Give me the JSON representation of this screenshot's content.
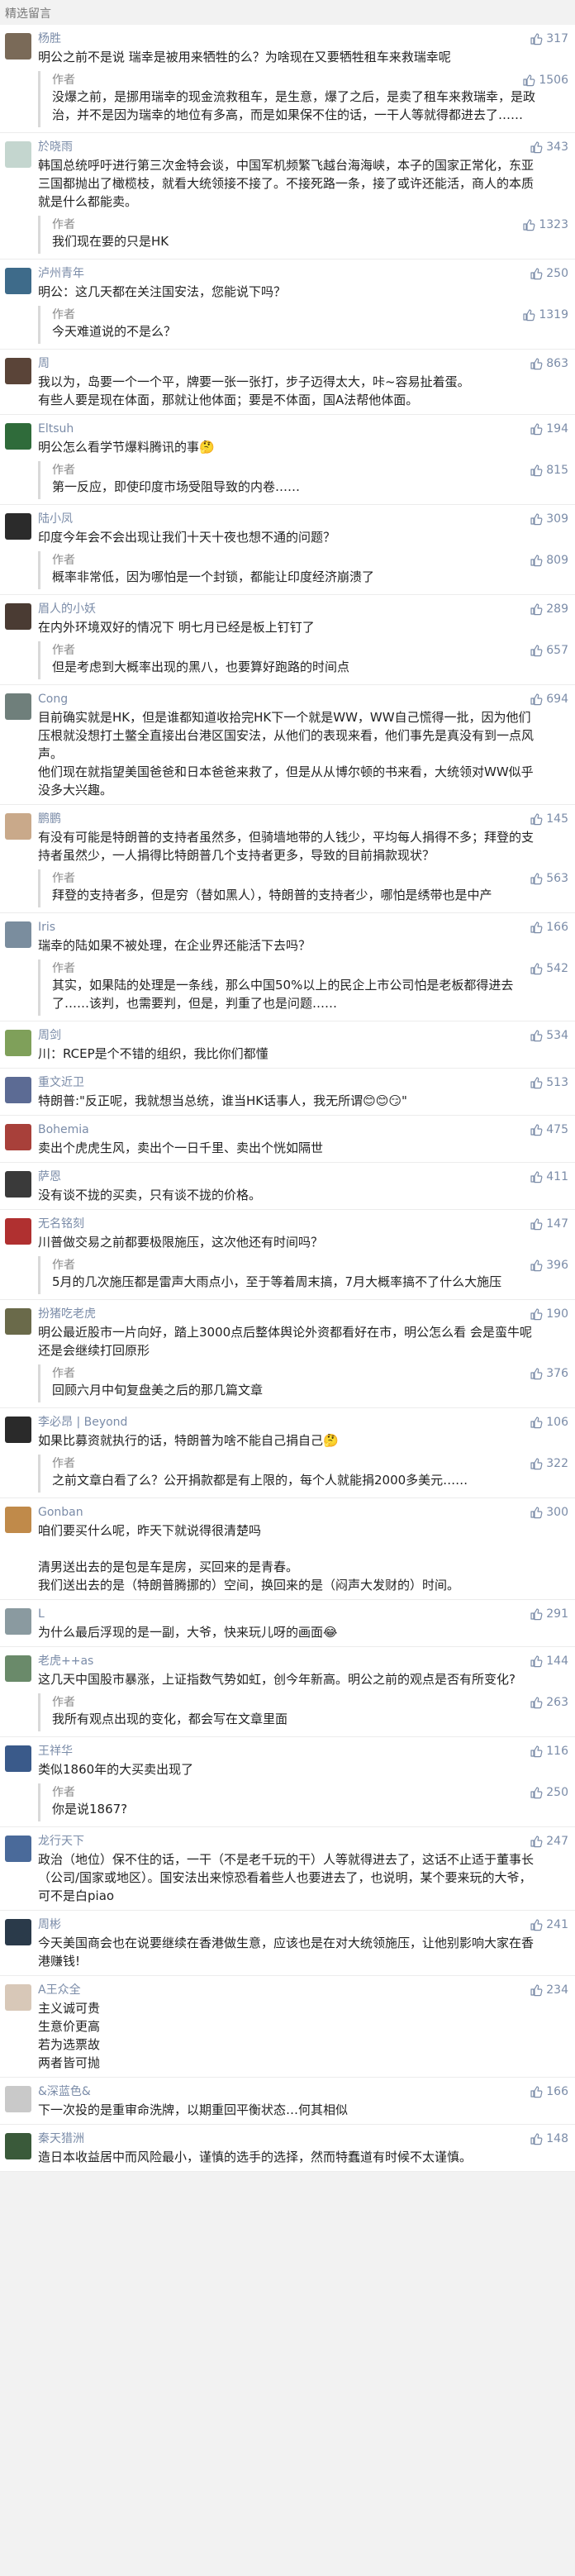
{
  "header": {
    "title": "精选留言"
  },
  "comments": [
    {
      "name": "杨胜",
      "likes": "317",
      "text": "明公之前不是说 瑞幸是被用来牺牲的么？为啥现在又要牺牲租车来救瑞幸呢",
      "reply": {
        "name": "作者",
        "likes": "1506",
        "text": "没爆之前，是挪用瑞幸的现金流救租车，是生意，爆了之后，是卖了租车来救瑞幸，是政治，并不是因为瑞幸的地位有多高，而是如果保不住的话，一干人等就得都进去了……"
      },
      "avatar": "#7a6a58"
    },
    {
      "name": "於晓雨",
      "likes": "343",
      "text": "韩国总统呼吁进行第三次金特会谈，中国军机频繁飞越台海海峡，本子的国家正常化，东亚三国都抛出了橄榄枝，就看大统领接不接了。不接死路一条，接了或许还能活，商人的本质就是什么都能卖。",
      "reply": {
        "name": "作者",
        "likes": "1323",
        "text": "我们现在要的只是HK"
      },
      "avatar": "#c4d6cf"
    },
    {
      "name": "泸州青年",
      "likes": "250",
      "text": "明公：这几天都在关注国安法，您能说下吗？",
      "reply": {
        "name": "作者",
        "likes": "1319",
        "text": "今天难道说的不是么？"
      },
      "avatar": "#3e6b8a"
    },
    {
      "name": "周",
      "likes": "863",
      "text": "我以为，岛要一个一个平，牌要一张一张打，步子迈得太大，咔~容易扯着蛋。\n有些人要是现在体面，那就让他体面；要是不体面，国A法帮他体面。",
      "reply": null,
      "avatar": "#5a4438"
    },
    {
      "name": "Eltsuh",
      "likes": "194",
      "text": "明公怎么看学节爆料腾讯的事🤔",
      "reply": {
        "name": "作者",
        "likes": "815",
        "text": "第一反应，即使印度市场受阻导致的内卷……"
      },
      "avatar": "#2f6b3a"
    },
    {
      "name": "陆小凤",
      "likes": "309",
      "text": "印度今年会不会出现让我们十天十夜也想不通的问题？",
      "reply": {
        "name": "作者",
        "likes": "809",
        "text": "概率非常低，因为哪怕是一个封锁，都能让印度经济崩溃了"
      },
      "avatar": "#2b2b2b"
    },
    {
      "name": "眉人的小妖",
      "likes": "289",
      "text": "在内外环境双好的情况下 明七月已经是板上钉钉了",
      "reply": {
        "name": "作者",
        "likes": "657",
        "text": "但是考虑到大概率出现的黑八，也要算好跑路的时间点"
      },
      "avatar": "#4a3b33"
    },
    {
      "name": "Cong",
      "likes": "694",
      "text": "目前确实就是HK，但是谁都知道收拾完HK下一个就是WW，WW自己慌得一批，因为他们压根就没想打土鳖全直接出台港区国安法，从他们的表现来看，他们事先是真没有到一点风声。\n他们现在就指望美国爸爸和日本爸爸来救了，但是从从博尔顿的书来看，大统领对WW似乎没多大兴趣。",
      "reply": null,
      "avatar": "#6f7f7b"
    },
    {
      "name": "鹏鹏",
      "likes": "145",
      "text": "有没有可能是特朗普的支持者虽然多，但骑墙地带的人钱少，平均每人捐得不多；拜登的支持者虽然少，一人捐得比特朗普几个支持者更多，导致的目前捐款现状？",
      "reply": {
        "name": "作者",
        "likes": "563",
        "text": "拜登的支持者多，但是穷（替如黑人），特朗普的支持者少，哪怕是绣带也是中产"
      },
      "avatar": "#c9a98a"
    },
    {
      "name": "Iris",
      "likes": "166",
      "text": "瑞幸的陆如果不被处理，在企业界还能活下去吗？",
      "reply": {
        "name": "作者",
        "likes": "542",
        "text": "其实，如果陆的处理是一条线，那么中国50%以上的民企上市公司怕是老板都得进去了……该判，也需要判，但是，判重了也是问题……"
      },
      "avatar": "#7a8d9e"
    },
    {
      "name": "周剑",
      "likes": "534",
      "text": "川：RCEP是个不错的组织，我比你们都懂",
      "reply": null,
      "avatar": "#7fa05a"
    },
    {
      "name": "重文近卫",
      "likes": "513",
      "text": "特朗普:\"反正呢，我就想当总统，谁当HK话事人，我无所谓😊😊😏\"",
      "reply": null,
      "avatar": "#5c6b94"
    },
    {
      "name": "Bohemia",
      "likes": "475",
      "text": "卖出个虎虎生风，卖出个一日千里、卖出个恍如隔世",
      "reply": null,
      "avatar": "#a8403a"
    },
    {
      "name": "萨恩",
      "likes": "411",
      "text": "没有谈不拢的买卖，只有谈不拢的价格。",
      "reply": null,
      "avatar": "#3a3a3a"
    },
    {
      "name": "无名铭刻",
      "likes": "147",
      "text": "川普做交易之前都要极限施压，这次他还有时间吗？",
      "reply": {
        "name": "作者",
        "likes": "396",
        "text": "5月的几次施压都是雷声大雨点小，至于等着周末搞，7月大概率搞不了什么大施压"
      },
      "avatar": "#b03030"
    },
    {
      "name": "扮猪吃老虎",
      "likes": "190",
      "text": "明公最近股市一片向好，踏上3000点后整体舆论外资都看好在市，明公怎么看 会是蛮牛呢还是会继续打回原形",
      "reply": {
        "name": "作者",
        "likes": "376",
        "text": "回顾六月中旬复盘美之后的那几篇文章"
      },
      "avatar": "#6a6a4a"
    },
    {
      "name": "李必昂 | Beyond",
      "likes": "106",
      "text": "如果比募资就执行的话，特朗普为啥不能自己捐自己🤔",
      "reply": {
        "name": "作者",
        "likes": "322",
        "text": "之前文章白看了么？公开捐款都是有上限的，每个人就能捐2000多美元……"
      },
      "avatar": "#2a2a2a"
    },
    {
      "name": "Gonban",
      "likes": "300",
      "text": "咱们要买什么呢，昨天下就说得很清楚吗\n\n清男送出去的是包是车是房，买回来的是青春。\n我们送出去的是（特朗普腾挪的）空间，换回来的是（闷声大发财的）时间。",
      "reply": null,
      "avatar": "#c08a4a"
    },
    {
      "name": "L",
      "likes": "291",
      "text": "为什么最后浮现的是一副，大爷，快来玩儿呀的画面😂",
      "reply": null,
      "avatar": "#8a9aa0"
    },
    {
      "name": "老虎++as",
      "likes": "144",
      "text": "这几天中国股市暴涨，上证指数气势如虹，创今年新高。明公之前的观点是否有所变化?",
      "reply": {
        "name": "作者",
        "likes": "263",
        "text": "我所有观点出现的变化，都会写在文章里面"
      },
      "avatar": "#6a8a6a"
    },
    {
      "name": "王祥华",
      "likes": "116",
      "text": "类似1860年的大买卖出现了",
      "reply": {
        "name": "作者",
        "likes": "250",
        "text": "你是说1867?"
      },
      "avatar": "#3a5a8a"
    },
    {
      "name": "龙行天下",
      "likes": "247",
      "text": "政治（地位）保不住的话，一干（不是老千玩的干）人等就得进去了，这话不止适于董事长（公司/国家或地区）。国安法出来惊恐看着些人也要进去了，也说明，某个要来玩的大爷，可不是白piao",
      "reply": null,
      "avatar": "#4a6a9a"
    },
    {
      "name": "周彬",
      "likes": "241",
      "text": "今天美国商会也在说要继续在香港做生意，应该也是在对大统领施压，让他别影响大家在香港赚钱!",
      "reply": null,
      "avatar": "#2a3a4a"
    },
    {
      "name": "A王众全",
      "likes": "234",
      "text": "主义诚可贵\n生意价更高\n若为选票故\n两者皆可抛",
      "reply": null,
      "avatar": "#d8c8b8"
    },
    {
      "name": "&深蓝色&",
      "likes": "166",
      "text": "下一次投的是重审命洗牌，以期重回平衡状态…何其相似",
      "reply": null,
      "avatar": "#c9c9c9"
    },
    {
      "name": "秦天猎洲",
      "likes": "148",
      "text": "造日本收益居中而风险最小，谨慎的选手的选择，然而特蠢道有时候不太谨慎。",
      "reply": null,
      "avatar": "#3a5a3a"
    }
  ]
}
